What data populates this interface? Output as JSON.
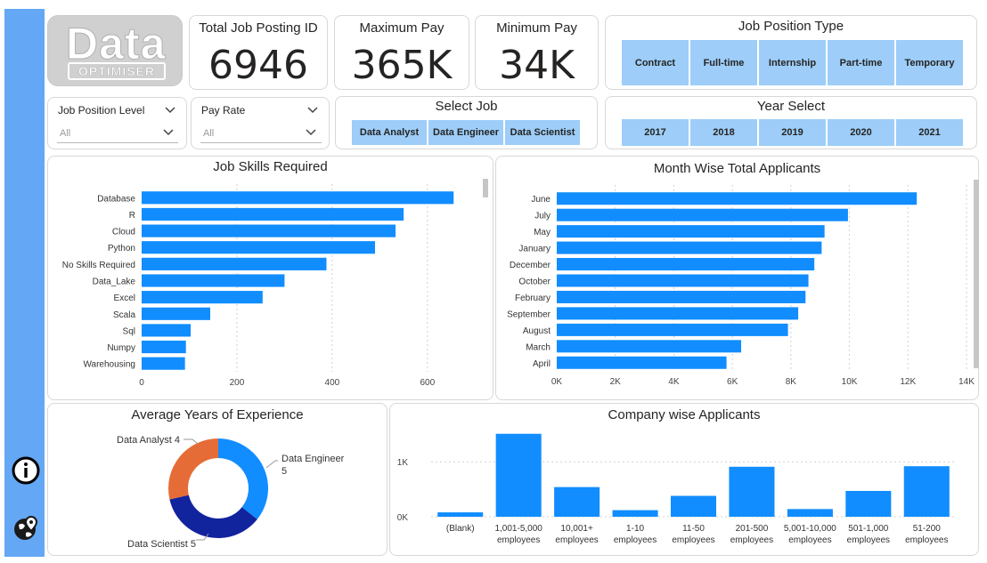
{
  "logo": {
    "word": "Data",
    "tagline": "OPTIMISER"
  },
  "kpis": [
    {
      "label": "Total Job Posting ID",
      "value": "6946"
    },
    {
      "label": "Maximum Pay",
      "value": "365K"
    },
    {
      "label": "Minimum Pay",
      "value": "34K"
    }
  ],
  "job_position_type": {
    "title": "Job Position Type",
    "options": [
      "Contract",
      "Full-time",
      "Internship",
      "Part-time",
      "Temporary"
    ]
  },
  "slicers": {
    "job_position_level": {
      "label": "Job Position Level",
      "value": "All"
    },
    "pay_rate": {
      "label": "Pay Rate",
      "value": "All"
    }
  },
  "select_job": {
    "title": "Select Job",
    "options": [
      "Data Analyst",
      "Data Engineer",
      "Data Scientist"
    ]
  },
  "year_select": {
    "title": "Year Select",
    "options": [
      "2017",
      "2018",
      "2019",
      "2020",
      "2021"
    ]
  },
  "sidebar": {
    "icons": [
      "info-icon",
      "globe-location-icon"
    ]
  },
  "chart_data": [
    {
      "type": "bar",
      "orientation": "horizontal",
      "title": "Job Skills Required",
      "categories": [
        "Database",
        "R",
        "Cloud",
        "Python",
        "No Skills Required",
        "Data_Lake",
        "Excel",
        "Scala",
        "Sql",
        "Numpy",
        "Warehousing"
      ],
      "values": [
        655,
        550,
        533,
        490,
        388,
        300,
        254,
        144,
        103,
        93,
        91
      ],
      "xticks": [
        "0",
        "200",
        "400",
        "600"
      ],
      "xlim": [
        0,
        720
      ],
      "color": "#118dff"
    },
    {
      "type": "bar",
      "orientation": "horizontal",
      "title": "Month Wise Total Applicants",
      "categories": [
        "June",
        "July",
        "May",
        "January",
        "December",
        "October",
        "February",
        "September",
        "August",
        "March",
        "April"
      ],
      "values": [
        12300,
        9950,
        9150,
        9050,
        8800,
        8600,
        8500,
        8250,
        7900,
        6300,
        5800
      ],
      "xticks": [
        "0K",
        "2K",
        "4K",
        "6K",
        "8K",
        "10K",
        "12K",
        "14K"
      ],
      "xlim": [
        0,
        14000
      ],
      "color": "#118dff"
    },
    {
      "type": "pie",
      "donut": true,
      "title": "Average Years of Experience",
      "labels": [
        "Data Engineer",
        "Data Scientist",
        "Data Analyst"
      ],
      "values": [
        5,
        5,
        4
      ],
      "display_labels": [
        "Data Engineer\n5",
        "Data Scientist 5",
        "Data Analyst 4"
      ],
      "colors": [
        "#118dff",
        "#12239e",
        "#e66c37"
      ]
    },
    {
      "type": "bar",
      "orientation": "vertical",
      "title": "Company wise Applicants",
      "categories": [
        "(Blank)",
        "1,001-5,000 employees",
        "10,001+ employees",
        "1-10 employees",
        "11-50 employees",
        "201-500 employees",
        "5,001-10,000 employees",
        "501-1,000 employees",
        "51-200 employees"
      ],
      "values": [
        80,
        1510,
        540,
        120,
        380,
        910,
        140,
        470,
        920
      ],
      "yticks": [
        "0K",
        "1K"
      ],
      "ylim": [
        0,
        1700
      ],
      "color": "#118dff"
    }
  ]
}
